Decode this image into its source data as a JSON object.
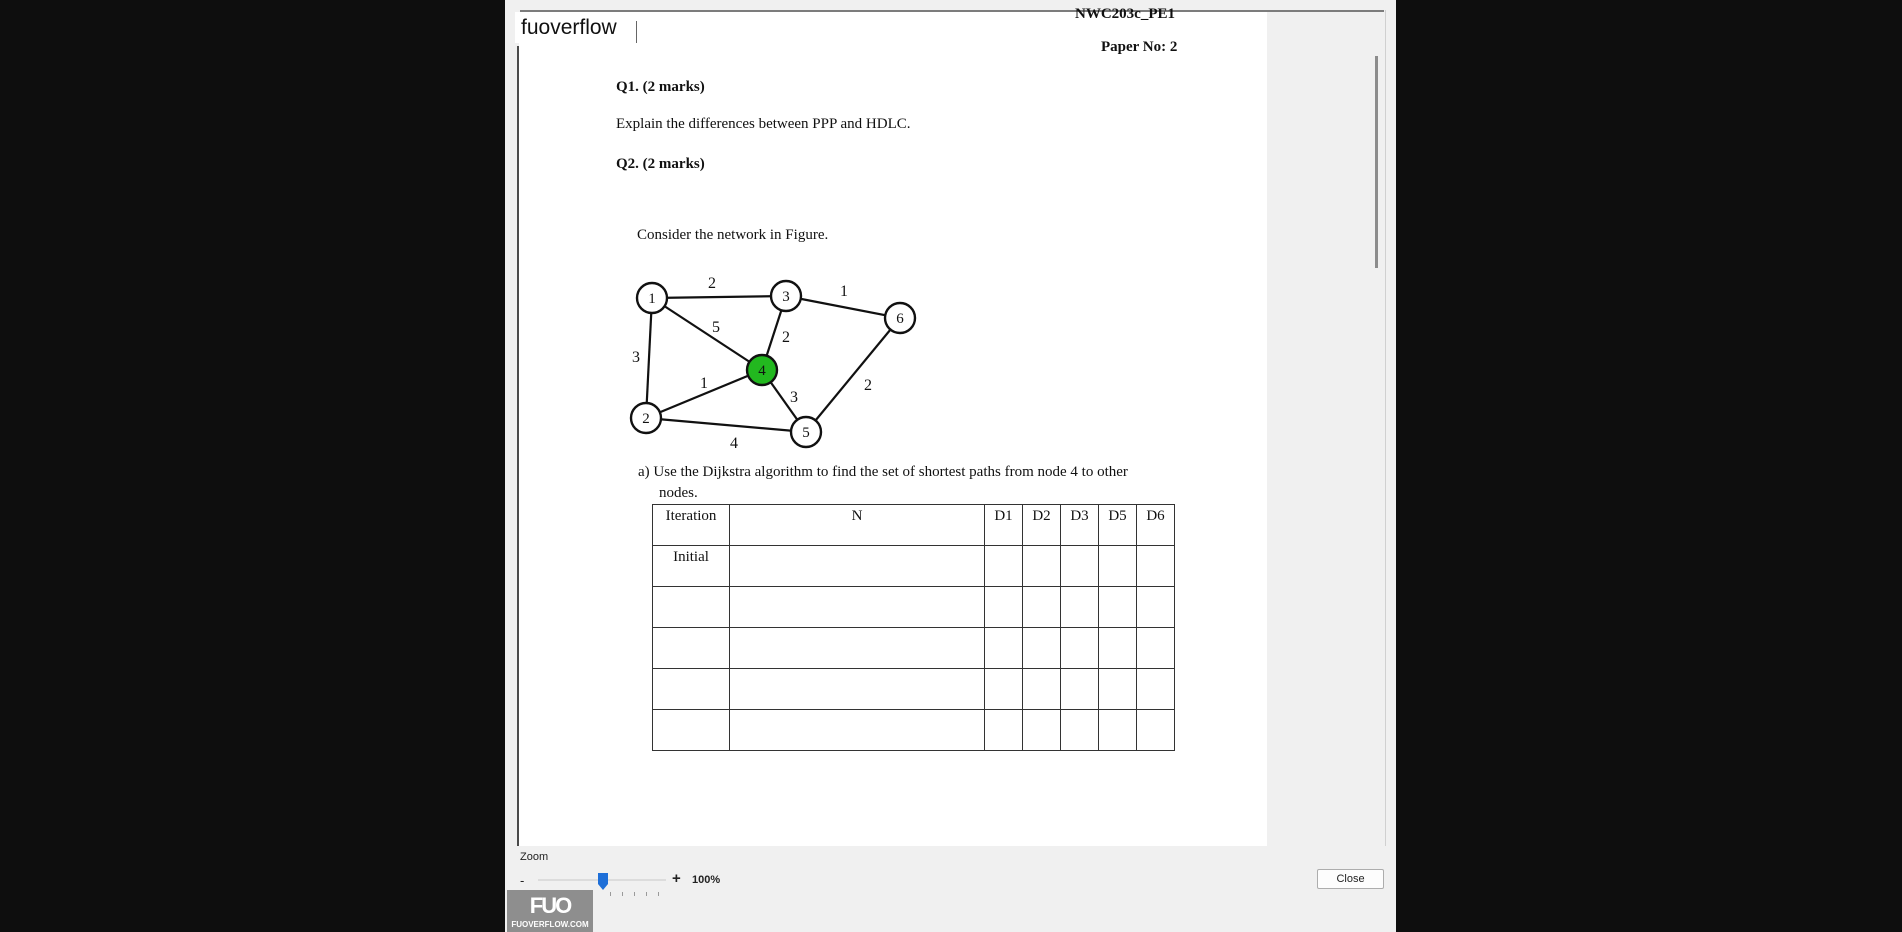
{
  "watermark": "fuoverflow",
  "header": {
    "code": "NWC203c_PE1",
    "paper": "Paper No: 2"
  },
  "q1": {
    "title": "Q1. (2 marks)",
    "text": "Explain the differences between PPP and HDLC."
  },
  "q2": {
    "title": "Q2. (2 marks)",
    "intro": "Consider the network in Figure.",
    "part_a_line1": "a)  Use the Dijkstra algorithm to find the set of shortest paths from node 4 to other",
    "part_a_line2": "nodes."
  },
  "graph": {
    "nodes": [
      {
        "id": "1",
        "color": "#ffffff"
      },
      {
        "id": "2",
        "color": "#ffffff"
      },
      {
        "id": "3",
        "color": "#ffffff"
      },
      {
        "id": "4",
        "color": "#22b81f"
      },
      {
        "id": "5",
        "color": "#ffffff"
      },
      {
        "id": "6",
        "color": "#ffffff"
      }
    ],
    "edges": [
      {
        "from": "1",
        "to": "3",
        "weight": "2"
      },
      {
        "from": "3",
        "to": "6",
        "weight": "1"
      },
      {
        "from": "1",
        "to": "4",
        "weight": "5"
      },
      {
        "from": "3",
        "to": "4",
        "weight": "2"
      },
      {
        "from": "1",
        "to": "2",
        "weight": "3"
      },
      {
        "from": "2",
        "to": "4",
        "weight": "1"
      },
      {
        "from": "4",
        "to": "5",
        "weight": "3"
      },
      {
        "from": "6",
        "to": "5",
        "weight": "2"
      },
      {
        "from": "2",
        "to": "5",
        "weight": "4"
      }
    ]
  },
  "table": {
    "headers": [
      "Iteration",
      "N",
      "D1",
      "D2",
      "D3",
      "D5",
      "D6"
    ],
    "rows": [
      [
        "Initial",
        "",
        "",
        "",
        "",
        "",
        ""
      ],
      [
        "",
        "",
        "",
        "",
        "",
        "",
        ""
      ],
      [
        "",
        "",
        "",
        "",
        "",
        "",
        ""
      ],
      [
        "",
        "",
        "",
        "",
        "",
        "",
        ""
      ],
      [
        "",
        "",
        "",
        "",
        "",
        "",
        ""
      ]
    ]
  },
  "zoom": {
    "label": "Zoom",
    "minus": "-",
    "plus": "+",
    "value": "100%",
    "level_percent": 100
  },
  "close_label": "Close",
  "logo": {
    "mark": "FUO",
    "sub": "FUOVERFLOW.COM"
  }
}
